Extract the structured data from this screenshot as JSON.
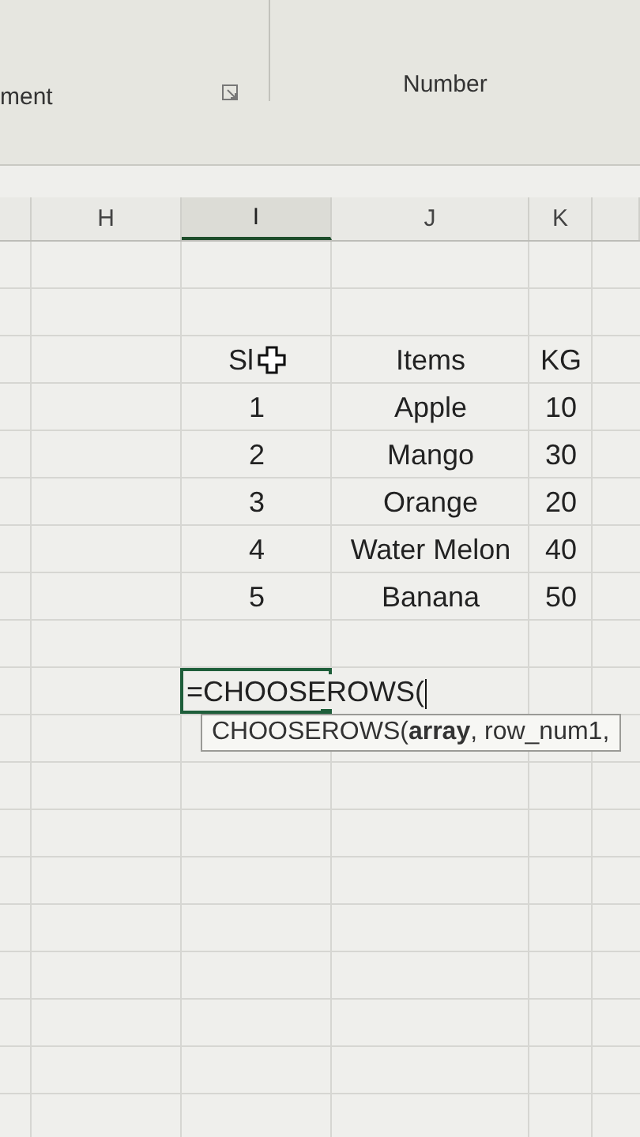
{
  "ribbon": {
    "groups": [
      {
        "label": "ment"
      },
      {
        "label": "Number"
      }
    ]
  },
  "columns": [
    {
      "label": "H",
      "selected": false
    },
    {
      "label": "I",
      "selected": true
    },
    {
      "label": "J",
      "selected": false
    },
    {
      "label": "K",
      "selected": false
    }
  ],
  "table": {
    "header": [
      "Sl",
      "Items",
      "KG"
    ],
    "rows": [
      [
        "1",
        "Apple",
        "10"
      ],
      [
        "2",
        "Mango",
        "30"
      ],
      [
        "3",
        "Orange",
        "20"
      ],
      [
        "4",
        "Water Melon",
        "40"
      ],
      [
        "5",
        "Banana",
        "50"
      ]
    ]
  },
  "formula_cell": {
    "value": "=CHOOSEROWS("
  },
  "tooltip": {
    "text": "CHOOSEROWS(**array**, row_num1,"
  }
}
